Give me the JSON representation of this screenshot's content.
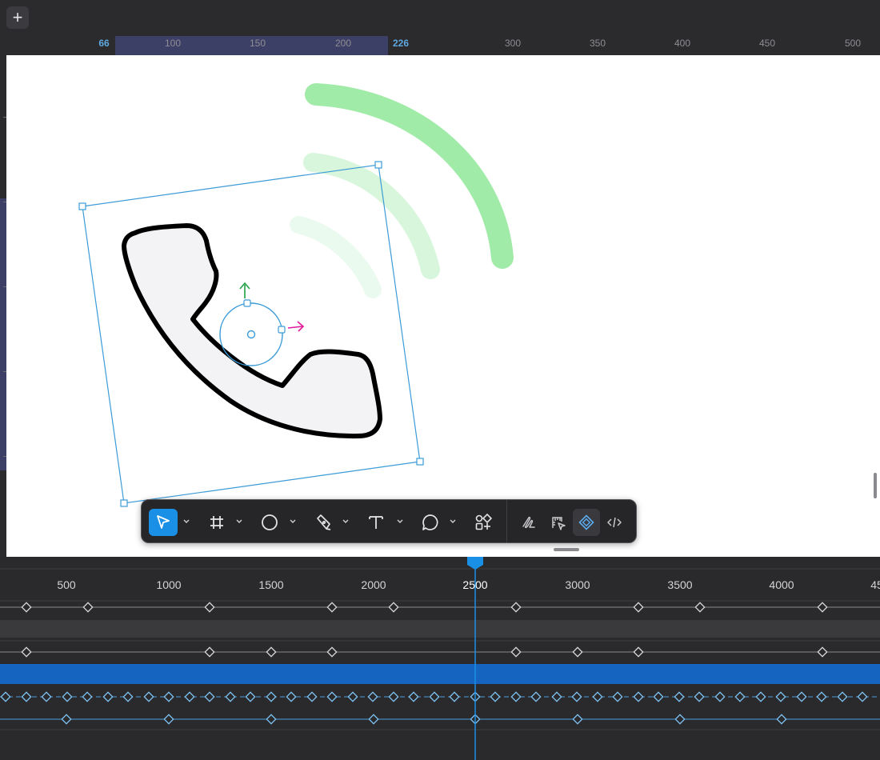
{
  "topbar": {
    "add_button_label": "+"
  },
  "ruler": {
    "selection_start_label": "66",
    "selection_end_label": "226",
    "ticks": [
      "100",
      "150",
      "200",
      "300",
      "350",
      "400",
      "450",
      "500"
    ]
  },
  "toolbar": {
    "tools": [
      {
        "name": "select-tool",
        "icon": "pointer-arrow-icon",
        "active": true,
        "has_caret": true
      },
      {
        "name": "frame-tool",
        "icon": "frame-hash-icon",
        "active": false,
        "has_caret": true
      },
      {
        "name": "ellipse-tool",
        "icon": "circle-icon",
        "active": false,
        "has_caret": true
      },
      {
        "name": "pen-tool",
        "icon": "pen-icon",
        "active": false,
        "has_caret": true
      },
      {
        "name": "text-tool",
        "icon": "text-t-icon",
        "active": false,
        "has_caret": true
      },
      {
        "name": "comment-tool",
        "icon": "speech-bubble-icon",
        "active": false,
        "has_caret": true
      },
      {
        "name": "assets-tool",
        "icon": "components-add-icon",
        "active": false,
        "has_caret": false
      }
    ],
    "mode_tools": [
      {
        "name": "draw-mode",
        "icon": "scribble-icon",
        "active": false
      },
      {
        "name": "design-mode",
        "icon": "ruler-pointer-icon",
        "active": false
      },
      {
        "name": "animate-mode",
        "icon": "keyframe-diamond-icon",
        "active": true
      },
      {
        "name": "dev-mode",
        "icon": "code-brackets-icon",
        "active": false
      }
    ]
  },
  "timeline": {
    "labels": [
      "500",
      "1000",
      "1500",
      "2000",
      "2500",
      "3000",
      "3500",
      "4000",
      "45"
    ],
    "playhead_time": "2500",
    "colors": {
      "accent": "#1a8fe6",
      "highlight_row": "#1565c0",
      "dim_row": "#3a3a3d"
    }
  },
  "canvas": {
    "colors": {
      "wave_strong": "#a1eba8",
      "wave_light": "#d8f6dc",
      "wave_faint": "#ebfaee",
      "phone_fill": "#f3f2f5",
      "selection": "#3b9bd8",
      "y_axis": "#22a045",
      "x_axis": "#e0199a"
    }
  }
}
